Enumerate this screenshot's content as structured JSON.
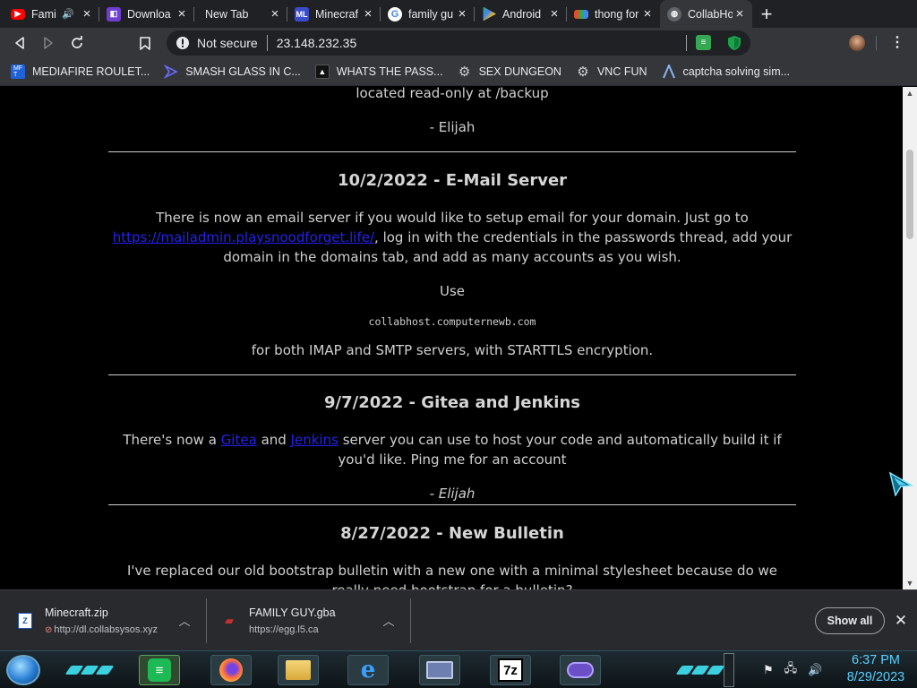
{
  "browser": {
    "tabs": [
      {
        "label": "Fami",
        "icon": "youtube-icon",
        "color": "#ff0000",
        "audio": true
      },
      {
        "label": "Downloa",
        "icon": "twitch-icon",
        "color": "#9146ff"
      },
      {
        "label": "New Tab",
        "icon": "",
        "color": ""
      },
      {
        "label": "Minecraf",
        "icon": "ml-icon",
        "color": "#3b4cca"
      },
      {
        "label": "family gu",
        "icon": "google-icon",
        "color": "#4285f4"
      },
      {
        "label": "Android",
        "icon": "play-store-icon",
        "color": "#34a853"
      },
      {
        "label": "thong for",
        "icon": "site-icon",
        "color": "#e44d26"
      },
      {
        "label": "CollabHo",
        "icon": "globe-icon",
        "color": "#9aa0a6",
        "active": true
      }
    ],
    "new_tab_glyph": "+",
    "address": {
      "security": "Not secure",
      "url": "23.148.232.35"
    },
    "bookmarks": [
      {
        "label": "MEDIAFIRE ROULET...",
        "icon": "mediafire-icon",
        "color": "#1f62d8"
      },
      {
        "label": "SMASH GLASS IN C...",
        "icon": "chevron-logo-icon",
        "color": "#5b5bff"
      },
      {
        "label": "WHATS THE PASS...",
        "icon": "hacker-icon",
        "color": "#333333"
      },
      {
        "label": "SEX DUNGEON",
        "icon": "gear-icon",
        "color": "#aaaaaa"
      },
      {
        "label": "VNC FUN",
        "icon": "gear-icon",
        "color": "#aaaaaa"
      },
      {
        "label": "captcha solving sim...",
        "icon": "a-logo-icon",
        "color": "#8ab4f8"
      }
    ]
  },
  "page": {
    "top_fragment": "located read-only at /backup",
    "top_signature": "- Elijah",
    "posts": [
      {
        "title": "10/2/2022 - E-Mail Server",
        "body_pre": "There is now an email server if you would like to setup email for your domain. Just go to",
        "link": "https://mailadmin.playsnoodforget.life/",
        "body_post": ", log in with the credentials in the passwords thread, add your domain in the domains tab, and add as many accounts as you wish.",
        "use_label": "Use",
        "code": "collabhost.computernewb.com",
        "footer": "for both IMAP and SMTP servers, with STARTTLS encryption."
      },
      {
        "title": "9/7/2022 - Gitea and Jenkins",
        "text1": "There's now a",
        "link1": "Gitea",
        "text2": "and",
        "link2": "Jenkins",
        "text3": "server you can use to host your code and automatically build it if you'd like. Ping me for an account",
        "signature": "- Elijah"
      },
      {
        "title": "8/27/2022 - New Bulletin",
        "body": "I've replaced our old bootstrap bulletin with a new one with a minimal stylesheet because do we really need bootstrap for a bulletin?"
      }
    ]
  },
  "downloads": {
    "items": [
      {
        "name": "Minecraft.zip",
        "url": "http://dl.collabsysos.xyz"
      },
      {
        "name": "FAMILY GUY.gba",
        "url": "https://egg.l5.ca"
      }
    ],
    "show_all": "Show all"
  },
  "taskbar": {
    "time": "6:37 PM",
    "date": "8/29/2023"
  }
}
